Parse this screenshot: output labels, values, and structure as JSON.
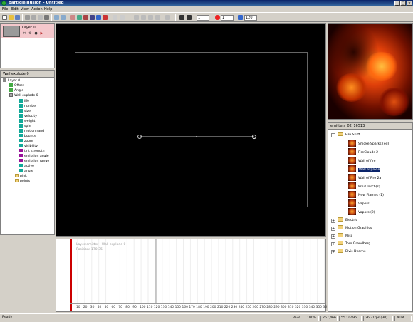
{
  "window": {
    "title": "particleIllusion - Untitled"
  },
  "menu": [
    "File",
    "Edit",
    "View",
    "Action",
    "Help"
  ],
  "toolbar": {
    "frame_value": "1",
    "end_value": "1",
    "fps_value": "120"
  },
  "layers": {
    "name": "Layer 0"
  },
  "emitter_tree": {
    "header": "Wall explode 0",
    "items": [
      "Layer 0",
      "Offset",
      "Angle",
      "Wall explode 0",
      "life",
      "number",
      "size",
      "velocity",
      "weight",
      "spin",
      "motion rand",
      "bounce",
      "zoom",
      "visibility",
      "tint strength",
      "emission angle",
      "emission range",
      "active",
      "angle",
      "pink",
      "points"
    ]
  },
  "library": {
    "header": "emitters_02_16513",
    "items": [
      {
        "label": "Fire Stuff",
        "kind": "folder"
      },
      {
        "label": "Smoke Sparks (ed)",
        "kind": "emitter"
      },
      {
        "label": "FireClouds 2",
        "kind": "emitter"
      },
      {
        "label": "Wall of fire",
        "kind": "emitter"
      },
      {
        "label": "Wall explode",
        "kind": "emitter"
      },
      {
        "label": "Wall of Fire 2a",
        "kind": "emitter"
      },
      {
        "label": "Whiz Torch(s)",
        "kind": "emitter"
      },
      {
        "label": "New Flames (1)",
        "kind": "emitter"
      },
      {
        "label": "Vapors",
        "kind": "emitter"
      },
      {
        "label": "Vapors (2)",
        "kind": "emitter"
      },
      {
        "label": "Electric",
        "kind": "folder"
      },
      {
        "label": "Motion Graphics",
        "kind": "folder"
      },
      {
        "label": "Misc",
        "kind": "folder"
      },
      {
        "label": "Tom Grandberg",
        "kind": "folder"
      },
      {
        "label": "Elvis Dearne",
        "kind": "folder"
      }
    ]
  },
  "timeline": {
    "info_line1": "Layer:emitter - Wall explode 0",
    "info_line2": "Position: 170,35",
    "ruler": [
      "10",
      "20",
      "30",
      "40",
      "50",
      "60",
      "70",
      "80",
      "90",
      "100",
      "110",
      "120",
      "130",
      "140",
      "150",
      "160",
      "170",
      "180",
      "190",
      "200",
      "210",
      "220",
      "230",
      "240",
      "250",
      "260",
      "270",
      "280",
      "290",
      "300",
      "310",
      "320",
      "330",
      "340",
      "350",
      "36"
    ]
  },
  "status": {
    "ready": "Ready",
    "mode": "RGB",
    "zoom": "100%",
    "coords": "267,466",
    "range": "55 : 0496",
    "fps": "26.31fps (30)",
    "num": "NUM"
  }
}
